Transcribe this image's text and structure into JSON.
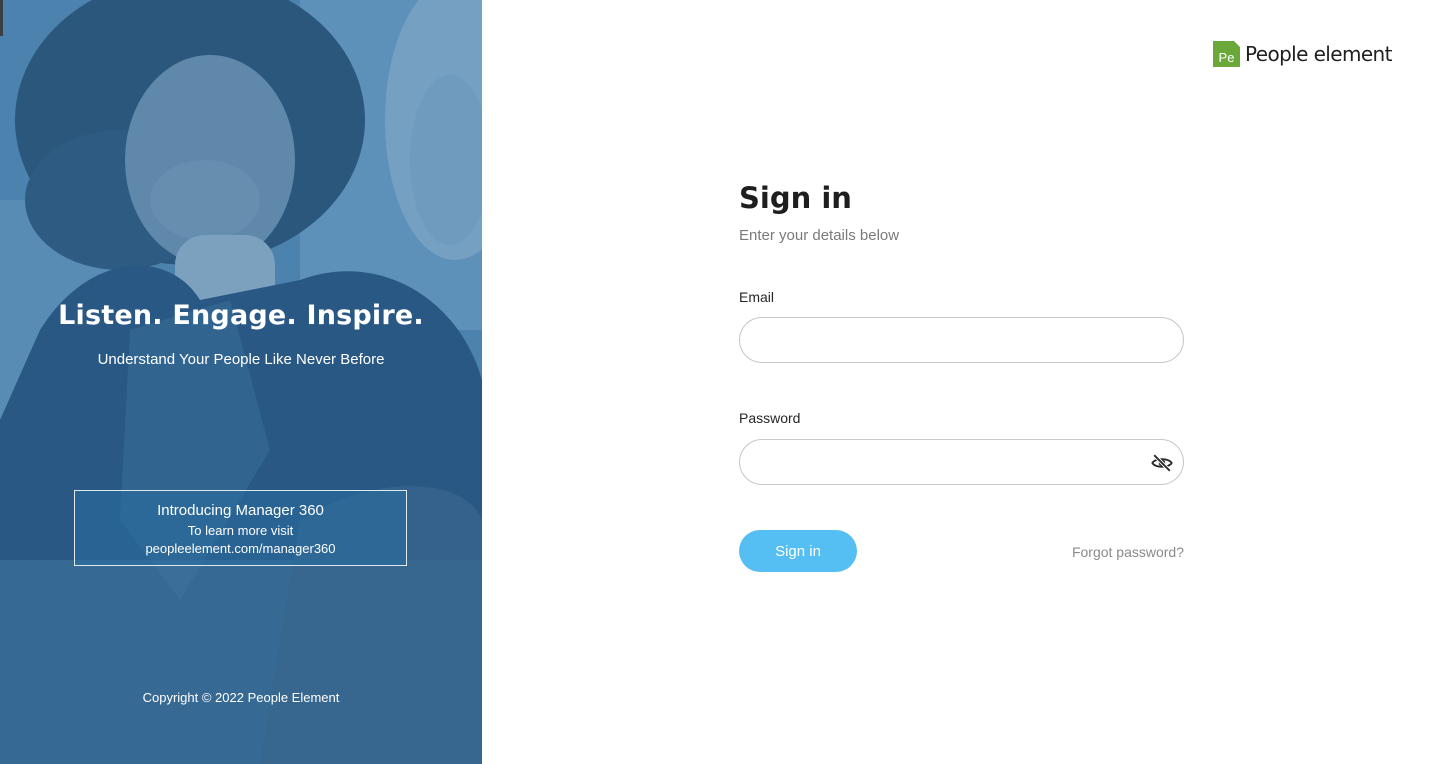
{
  "hero": {
    "headline": "Listen. Engage. Inspire.",
    "subheadline": "Understand Your People Like Never Before",
    "promo": {
      "title": "Introducing Manager 360",
      "line1": "To learn more visit",
      "line2": "peopleelement.com/manager360"
    },
    "copyright": "Copyright © 2022 People Element"
  },
  "logo": {
    "mark": "Pe",
    "text": "People element",
    "color": "#6aa83a"
  },
  "form": {
    "title": "Sign in",
    "subtitle": "Enter your details below",
    "email": {
      "label": "Email",
      "value": "",
      "placeholder": ""
    },
    "password": {
      "label": "Password",
      "value": "",
      "placeholder": "",
      "toggle_icon": "eye-off-icon"
    },
    "submit_label": "Sign in",
    "forgot_label": "Forgot password?",
    "accent": "#55bff3"
  }
}
